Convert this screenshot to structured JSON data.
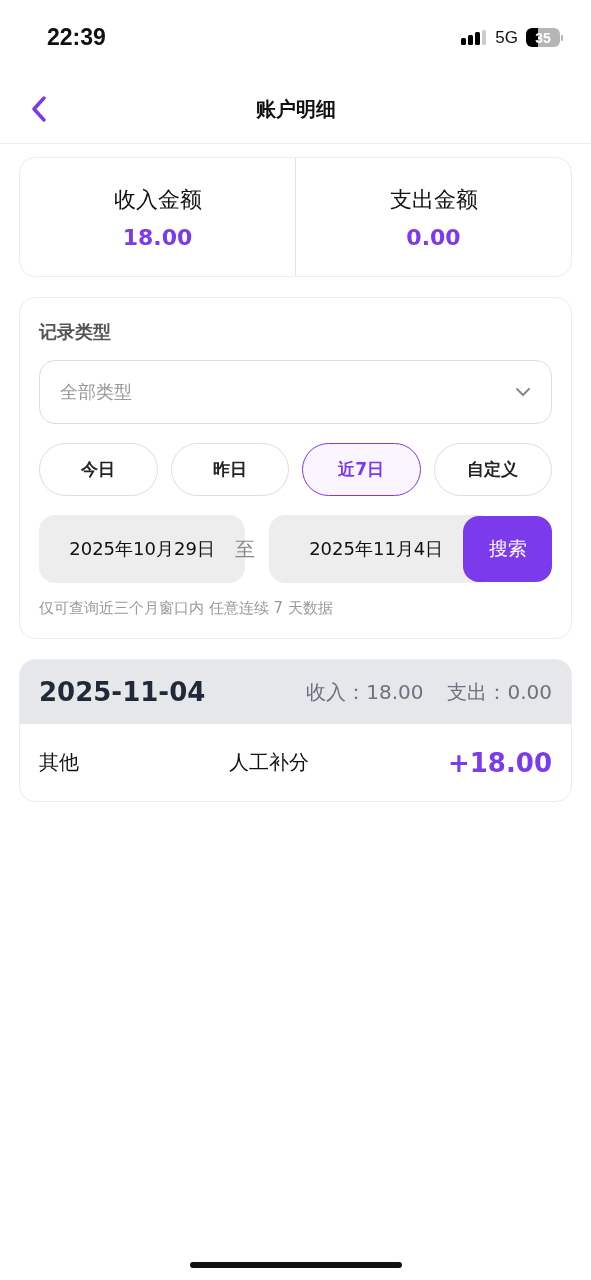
{
  "status_bar": {
    "time": "22:39",
    "network": "5G",
    "battery": "35"
  },
  "nav": {
    "title": "账户明细"
  },
  "summary": [
    {
      "label": "收入金额",
      "value": "18.00"
    },
    {
      "label": "支出金额",
      "value": "0.00"
    }
  ],
  "filter": {
    "label": "记录类型",
    "type_select": {
      "placeholder": "全部类型"
    },
    "ranges": [
      {
        "label": "今日",
        "selected": false
      },
      {
        "label": "昨日",
        "selected": false
      },
      {
        "label": "近7日",
        "selected": true
      },
      {
        "label": "自定义",
        "selected": false
      }
    ],
    "start_date": "2025年10月29日",
    "separator": "至",
    "end_date": "2025年11月4日",
    "search_button": "搜索",
    "hint": "仅可查询近三个月窗口内 任意连续 7 天数据"
  },
  "days": [
    {
      "date": "2025-11-04",
      "income": "收入：18.00",
      "expense": "支出：0.00",
      "records": [
        {
          "category": "其他",
          "description": "人工补分",
          "amount": "+18.00"
        }
      ]
    }
  ]
}
